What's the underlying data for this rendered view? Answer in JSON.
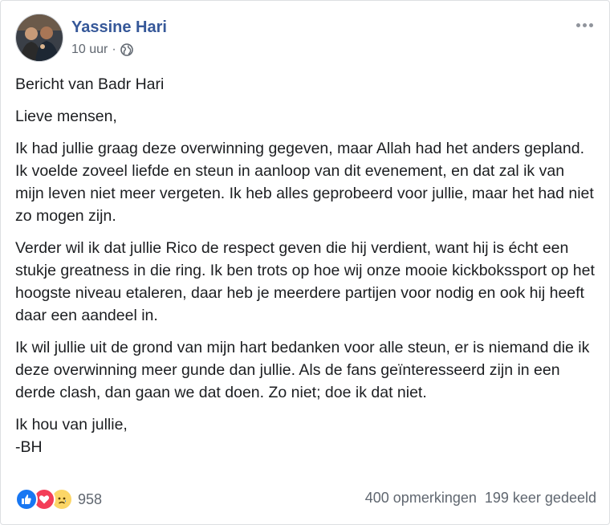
{
  "post": {
    "author": "Yassine Hari",
    "timestamp": "10 uur",
    "separator": "·",
    "audience_icon": "globe-icon",
    "paragraphs": [
      "Bericht van Badr Hari",
      "Lieve mensen,",
      "Ik had jullie graag deze overwinning gegeven, maar Allah had het anders gepland. Ik voelde zoveel liefde en steun in aanloop van dit evenement, en dat zal ik van mijn leven niet meer vergeten. Ik heb alles geprobeerd voor jullie, maar het had niet zo mogen zijn.",
      "Verder wil ik dat jullie Rico de respect geven die hij verdient, want hij is écht een stukje greatness in die ring. Ik ben trots op hoe wij onze mooie kickbokssport op het hoogste niveau etaleren, daar heb je meerdere partijen voor nodig en ook hij heeft daar een aandeel in.",
      "Ik wil jullie uit de grond van mijn hart bedanken voor alle steun, er is niemand die ik deze overwinning meer gunde dan jullie. Als de fans geïnteresseerd zijn in een derde clash, dan gaan we dat doen. Zo niet; doe ik dat niet.",
      "Ik hou van jullie,",
      "-BH"
    ]
  },
  "footer": {
    "reactions": [
      "like-icon",
      "love-icon",
      "sad-icon"
    ],
    "reaction_count": "958",
    "comments": "400 opmerkingen",
    "shares": "199 keer gedeeld"
  },
  "colors": {
    "author_link": "#365899",
    "meta_text": "#606770",
    "like": "#1877f2",
    "love": "#f33e58",
    "sad": "#fcd667"
  }
}
